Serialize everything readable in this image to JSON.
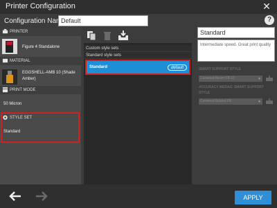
{
  "window": {
    "title": "Printer Configuration"
  },
  "config": {
    "label": "Configuration Name:",
    "value": "Default"
  },
  "sidebar": {
    "printer": {
      "header": "PRINTER",
      "name": "Figure 4 Standalone"
    },
    "material": {
      "header": "MATERIAL",
      "name_line1": "EGGSHELL-AMB 10 (Shade",
      "name_line2": "Amber)"
    },
    "print_mode": {
      "header": "PRINT MODE",
      "value": "50 Micron"
    },
    "style_set": {
      "header": "STYLE SET",
      "value": "Standard"
    }
  },
  "list": {
    "custom_header": "Custom style sets",
    "standard_header": "Standard style sets",
    "selected": {
      "label": "Standard",
      "badge": "default"
    }
  },
  "details": {
    "name": "Standard",
    "description": "Intermediate speed. Great print quality",
    "smart_support_label": "SMART SUPPORT STYLE",
    "smart_support_value": "Centered Beam FB 10",
    "accuracy_label_line1": "ACCURACY MESAIC SMART SUPPORT",
    "accuracy_label_line2": "STYLE",
    "accuracy_value": "Centered Bolded FB"
  },
  "footer": {
    "apply_label": "APPLY"
  },
  "colors": {
    "accent": "#2e8fd8",
    "highlight": "#d02020",
    "selected": "#1e8fd6"
  },
  "icons": [
    "close-icon",
    "help-icon",
    "printer-icon",
    "material-icon",
    "print-mode-icon",
    "gear-icon",
    "copy-icon",
    "trash-icon",
    "import-icon",
    "back-arrow-icon",
    "forward-arrow-icon"
  ]
}
